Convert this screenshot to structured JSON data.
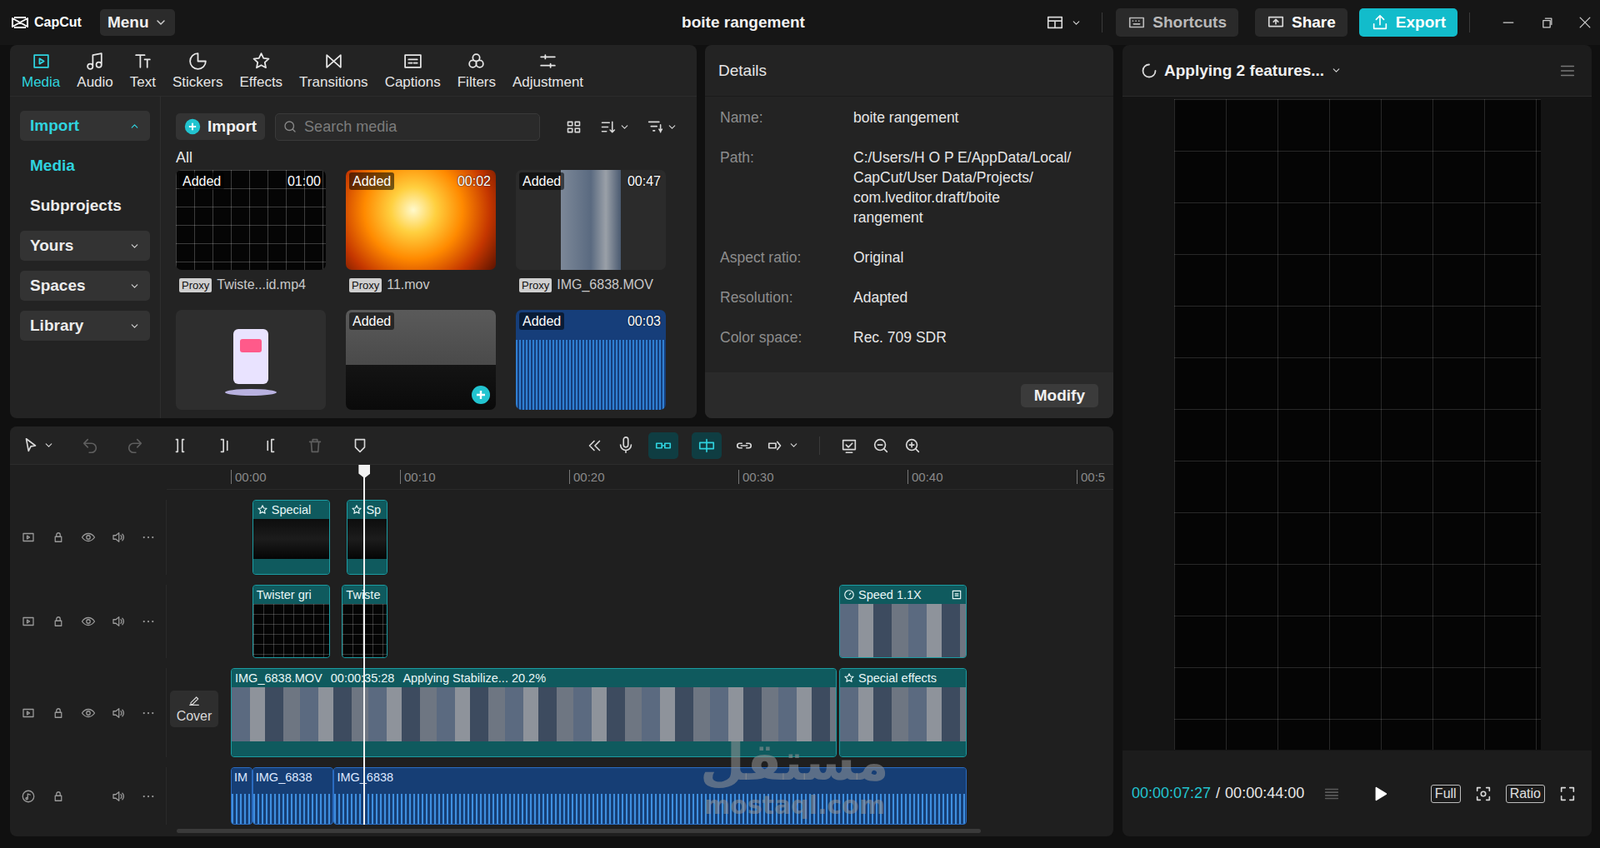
{
  "app": {
    "name": "CapCut"
  },
  "menu": {
    "label": "Menu"
  },
  "window": {
    "title": "boite rangement"
  },
  "title_buttons": [
    {
      "label": "Shortcuts",
      "kind": "shortcuts"
    },
    {
      "label": "Share",
      "kind": "share"
    },
    {
      "label": "Export",
      "kind": "export"
    }
  ],
  "tabs": [
    {
      "label": "Media",
      "selected": true
    },
    {
      "label": "Audio",
      "selected": false
    },
    {
      "label": "Text",
      "selected": false
    },
    {
      "label": "Stickers",
      "selected": false
    },
    {
      "label": "Effects",
      "selected": false
    },
    {
      "label": "Transitions",
      "selected": false
    },
    {
      "label": "Captions",
      "selected": false
    },
    {
      "label": "Filters",
      "selected": false
    },
    {
      "label": "Adjustment",
      "selected": false
    }
  ],
  "sidebar": {
    "items": [
      {
        "label": "Import",
        "kind": "group",
        "expanded": true,
        "selected": true
      },
      {
        "label": "Media",
        "kind": "item",
        "expanded": false,
        "selected": true
      },
      {
        "label": "Subprojects",
        "kind": "item",
        "expanded": false,
        "selected": false
      },
      {
        "label": "Yours",
        "kind": "group",
        "expanded": false,
        "selected": false
      },
      {
        "label": "Spaces",
        "kind": "group",
        "expanded": false,
        "selected": false
      },
      {
        "label": "Library",
        "kind": "group",
        "expanded": false,
        "selected": false
      }
    ]
  },
  "media": {
    "import_label": "Import",
    "search_placeholder": "Search media",
    "filter_label": "All",
    "items": [
      {
        "kind": "grid",
        "badge": "Added",
        "duration": "01:00",
        "proxy": "Proxy",
        "name": "Twiste...id.mp4",
        "add_button": false
      },
      {
        "kind": "fire",
        "badge": "Added",
        "duration": "00:02",
        "proxy": "Proxy",
        "name": "11.mov",
        "add_button": false
      },
      {
        "kind": "photo",
        "badge": "Added",
        "duration": "00:47",
        "proxy": "Proxy",
        "name": "IMG_6838.MOV",
        "add_button": false
      },
      {
        "kind": "illustration",
        "badge": "",
        "duration": "",
        "proxy": "",
        "name": "",
        "add_button": false
      },
      {
        "kind": "crowd",
        "badge": "Added",
        "duration": "",
        "proxy": "",
        "name": "",
        "add_button": true
      },
      {
        "kind": "audio",
        "badge": "Added",
        "duration": "00:03",
        "proxy": "",
        "name": "",
        "add_button": false
      }
    ]
  },
  "details": {
    "title": "Details",
    "rows": [
      {
        "label": "Name:",
        "lines": [
          "boite rangement"
        ]
      },
      {
        "label": "Path:",
        "lines": [
          "C:/Users/H O P E/AppData/Local/",
          "CapCut/User Data/Projects/",
          "com.lveditor.draft/boite",
          "rangement"
        ]
      },
      {
        "label": "Aspect ratio:",
        "lines": [
          "Original"
        ]
      },
      {
        "label": "Resolution:",
        "lines": [
          "Adapted"
        ]
      },
      {
        "label": "Color space:",
        "lines": [
          "Rec. 709 SDR"
        ]
      }
    ],
    "button": "Modify"
  },
  "preview": {
    "status": "Applying 2 features...",
    "current_time": "00:00:07:27",
    "separator": "/",
    "total_time": "00:00:44:00",
    "buttons": [
      "Full",
      "Ratio"
    ]
  },
  "timeline": {
    "toolbar": {
      "undo_disabled": true,
      "redo_disabled": true,
      "delete_disabled": true,
      "magnet_on": true,
      "snap_on": true
    },
    "ruler": {
      "labels": [
        "00:00",
        "00:10",
        "00:20",
        "00:30",
        "00:40",
        "00:5"
      ],
      "interval_seconds": 10
    },
    "playhead_seconds": 7.9,
    "tracks": [
      {
        "kind": "effect",
        "cover": "",
        "clips": [
          {
            "start": 1.27,
            "end": 5.84,
            "kind": "effect",
            "texts": [
              "Special"
            ]
          },
          {
            "start": 6.87,
            "end": 9.28,
            "kind": "effect",
            "texts": [
              "Sp"
            ]
          }
        ]
      },
      {
        "kind": "video",
        "cover": "",
        "clips": [
          {
            "start": 1.27,
            "end": 5.84,
            "kind": "grid",
            "texts": [
              "Twister gri"
            ]
          },
          {
            "start": 6.57,
            "end": 9.28,
            "kind": "grid",
            "texts": [
              "Twiste"
            ]
          },
          {
            "start": 35.96,
            "end": 43.5,
            "kind": "speed",
            "texts": [
              "Speed 1.1X"
            ]
          }
        ]
      },
      {
        "kind": "main",
        "cover": "Cover",
        "clips": [
          {
            "start": 0,
            "end": 35.8,
            "kind": "main",
            "texts": [
              "IMG_6838.MOV",
              "00:00:35:28",
              "Applying Stabilize... 20.2%"
            ]
          },
          {
            "start": 35.96,
            "end": 43.5,
            "kind": "main-effect",
            "texts": [
              "Special effects"
            ]
          }
        ]
      },
      {
        "kind": "audio",
        "cover": "",
        "clips": [
          {
            "start": 0,
            "end": 1.27,
            "kind": "audio",
            "texts": [
              "IM"
            ]
          },
          {
            "start": 1.27,
            "end": 6.08,
            "kind": "audio",
            "texts": [
              "IMG_6838"
            ]
          },
          {
            "start": 6.08,
            "end": 43.5,
            "kind": "audio",
            "texts": [
              "IMG_6838"
            ]
          }
        ]
      }
    ]
  },
  "watermark": {
    "text": "مستقل",
    "url": "mostaql.com"
  }
}
